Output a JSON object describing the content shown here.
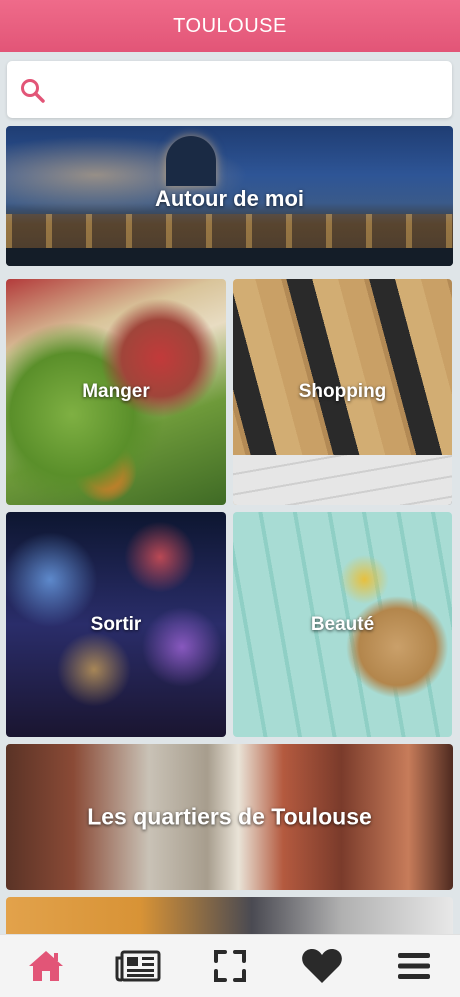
{
  "header": {
    "title": "TOULOUSE"
  },
  "search": {
    "placeholder": "",
    "value": ""
  },
  "tiles": {
    "autour": {
      "label": "Autour de moi"
    },
    "manger": {
      "label": "Manger"
    },
    "shopping": {
      "label": "Shopping"
    },
    "sortir": {
      "label": "Sortir"
    },
    "beaute": {
      "label": "Beauté"
    },
    "quartiers": {
      "label": "Les quartiers de Toulouse"
    }
  },
  "nav": {
    "items": [
      {
        "icon": "home-icon",
        "active": true
      },
      {
        "icon": "newspaper-icon",
        "active": false
      },
      {
        "icon": "scan-icon",
        "active": false
      },
      {
        "icon": "heart-icon",
        "active": false
      },
      {
        "icon": "menu-icon",
        "active": false
      }
    ]
  },
  "colors": {
    "accent": "#e25577",
    "nav_icon": "#2a2a2a"
  }
}
